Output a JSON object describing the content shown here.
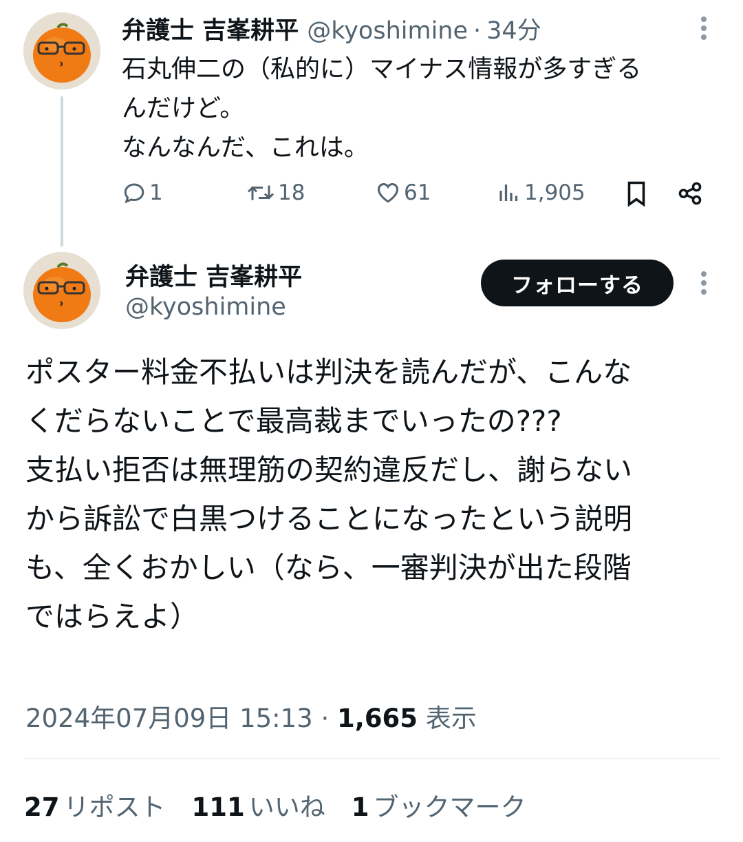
{
  "tweet1": {
    "display_name": "弁護士 吉峯耕平",
    "handle": "@kyoshimine",
    "separator": "·",
    "time": "34分",
    "text_lines": [
      "石丸伸二の（私的に）マイナス情報が多すぎる",
      "んだけど。",
      "なんなんだ、これは。"
    ],
    "replies": "1",
    "reposts": "18",
    "likes": "61",
    "views": "1,905"
  },
  "tweet2": {
    "display_name": "弁護士 吉峯耕平",
    "handle": "@kyoshimine",
    "follow_label": "フォローする",
    "text_lines": [
      "ポスター料金不払いは判決を読んだが、こんな",
      "くだらないことで最高裁までいったの???",
      "支払い拒否は無理筋の契約違反だし、謝らない",
      "から訴訟で白黒つけることになったという説明",
      "も、全くおかしい（なら、一審判決が出た段階",
      "ではらえよ）"
    ],
    "date": "2024年07月09日 15:13",
    "separator": "·",
    "views_count": "1,665",
    "views_label": "表示",
    "stats": {
      "reposts_count": "27",
      "reposts_label": "リポスト",
      "likes_count": "111",
      "likes_label": "いいね",
      "bookmarks_count": "1",
      "bookmarks_label": "ブックマーク"
    }
  },
  "icons": {
    "reply": "reply-icon",
    "repost": "repost-icon",
    "like": "heart-icon",
    "views": "views-icon",
    "bookmark": "bookmark-icon",
    "share": "share-icon",
    "more": "more-vertical-icon"
  },
  "colors": {
    "text": "#0f1419",
    "secondary": "#536471",
    "follow_button": "#0f1419",
    "divider": "#eff3f4"
  }
}
